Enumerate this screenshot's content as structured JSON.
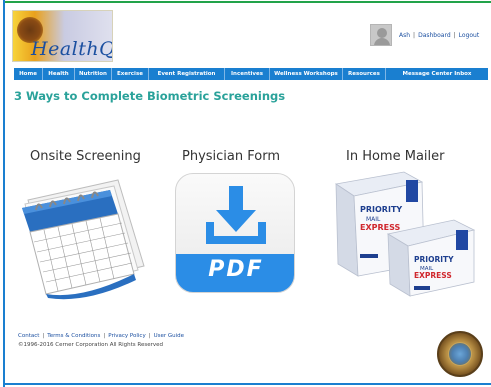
{
  "header": {
    "logo_text": "HealthQuest",
    "user_name": "Ash",
    "separator": "|",
    "dashboard_label": "Dashboard",
    "logout_label": "Logout"
  },
  "nav": {
    "items": [
      {
        "label": "Home"
      },
      {
        "label": "Health"
      },
      {
        "label": "Nutrition"
      },
      {
        "label": "Exercise"
      },
      {
        "label": "Event Registration"
      },
      {
        "label": "Incentives"
      },
      {
        "label": "Wellness Workshops"
      },
      {
        "label": "Resources"
      },
      {
        "label": "Message Center Inbox"
      }
    ]
  },
  "main": {
    "title": "3 Ways to Complete Biometric Screenings",
    "options": [
      {
        "label": "Onsite Screening",
        "icon": "calendar-icon"
      },
      {
        "label": "Physician Form",
        "icon": "pdf-download-icon"
      },
      {
        "label": "In Home Mailer",
        "icon": "mailer-boxes-icon"
      }
    ],
    "pdf_label": "PDF",
    "box_brand_1": "PRIORITY",
    "box_brand_2": "MAIL",
    "box_brand_3": "EXPRESS"
  },
  "footer": {
    "links": [
      "Contact",
      "Terms & Conditions",
      "Privacy Policy",
      "User Guide"
    ],
    "separator": "|",
    "copyright": "©1996-2016 Cerner Corporation All Rights Reserved"
  },
  "colors": {
    "nav_bg": "#1a7fd0",
    "title": "#2aa29a",
    "link": "#1b4fa0",
    "pdf_blue": "#2b8de6"
  }
}
